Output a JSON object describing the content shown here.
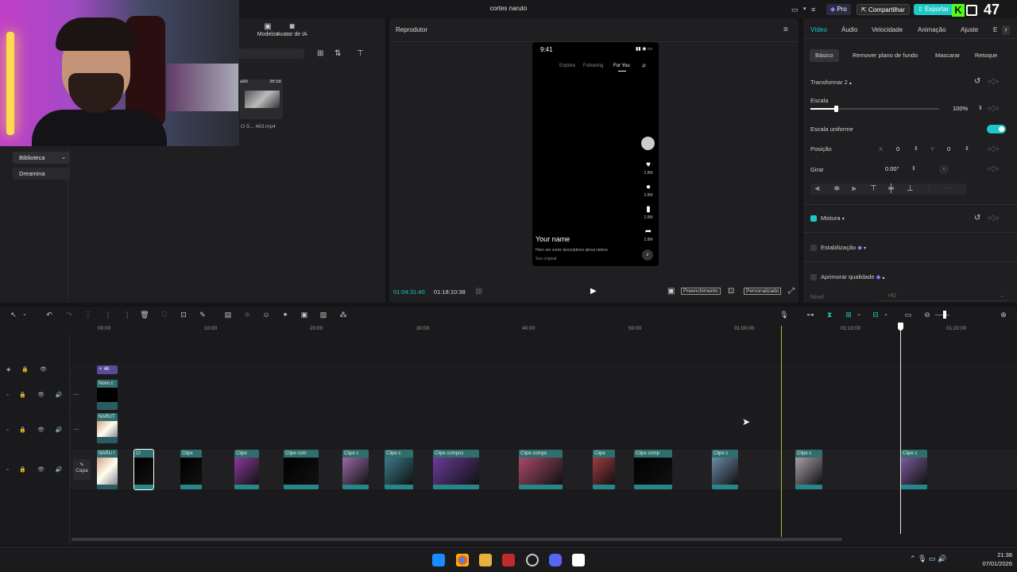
{
  "window": {
    "title": "cortes naruto"
  },
  "header": {
    "pro_label": "Pro",
    "share_label": "Compartilhar",
    "export_label": "Exportar",
    "counter": "47",
    "k_label": "K"
  },
  "media_panel": {
    "tabs": [
      {
        "label": "Modelos"
      },
      {
        "label": "Avatar de IA"
      }
    ],
    "media_item": {
      "name": "O S... 463.mp4",
      "duration": "36:58",
      "badge": "ado"
    },
    "nav": [
      {
        "label": "Biblioteca"
      },
      {
        "label": "Dreamina"
      }
    ]
  },
  "player": {
    "title": "Reprodutor",
    "phone": {
      "time": "9:41",
      "tabs": [
        "Explore",
        "Following",
        "For You"
      ],
      "counts": [
        "2.8M",
        "2.8M",
        "2.8M",
        "2.8M"
      ],
      "username": "Your name",
      "description": "Here are some descriptions about videos",
      "see_original": "See original"
    },
    "current_time": "01:04:31:40",
    "total_time": "01:18:10:38",
    "fill_label": "Preenchimento",
    "custom_label": "Personalizado"
  },
  "inspector": {
    "tabs": [
      "Vídeo",
      "Áudio",
      "Velocidade",
      "Animação",
      "Ajuste",
      "E"
    ],
    "subtabs": [
      "Básico",
      "Remover plano de fundo",
      "Mascarar",
      "Retoque"
    ],
    "transform_label": "Transformar 2",
    "scale_label": "Escala",
    "scale_value": "100%",
    "scale_level": 0.2,
    "uniform_label": "Escala uniforme",
    "position_label": "Posição",
    "x_label": "X",
    "x_value": "0",
    "y_label": "Y",
    "y_value": "0",
    "rotate_label": "Girar",
    "rotate_value": "0.00°",
    "rotate_extra": "-",
    "blend_label": "Mistura",
    "stabilize_label": "Estabilização",
    "enhance_label": "Aprimorar qualidade",
    "level_label": "Nível",
    "level_value": "HD"
  },
  "timeline": {
    "ruler": [
      "00:00",
      "10:00",
      "20:00",
      "30:00",
      "40:00",
      "50:00",
      "01:00:00",
      "01:10:00",
      "01:20:00"
    ],
    "tracks": {
      "effect_label": "4K",
      "text_label": "Novo c",
      "overlay_label": "NARUT",
      "main_label": "NARU I",
      "cover_label": "Capa"
    },
    "clips": [
      {
        "label": "Cl",
        "color": "#000000"
      },
      {
        "label": "Clipe",
        "color": "#000000"
      },
      {
        "label": "Clipe",
        "color": "#8a3a9a"
      },
      {
        "label": "Clipe com",
        "color": "#000000"
      },
      {
        "label": "Clipe c",
        "color": "#9a6aa8"
      },
      {
        "label": "Clipe c",
        "color": "#3a7a8a"
      },
      {
        "label": "Clipe compos",
        "color": "#6a3a9a"
      },
      {
        "label": "Clipe compo",
        "color": "#a84a6a"
      },
      {
        "label": "Clipe",
        "color": "#a03a40"
      },
      {
        "label": "Clipe comp",
        "color": "#000000"
      },
      {
        "label": "Clipe c",
        "color": "#6a8aa8"
      },
      {
        "label": "Clipe c",
        "color": "#a8a0a8"
      },
      {
        "label": "Clipe c",
        "color": "#7a5a9a"
      }
    ]
  },
  "taskbar": {
    "time": "21:38",
    "date": "07/01/2026"
  },
  "colors": {
    "accent": "#1fc7c7",
    "panel": "#1f1f21",
    "background": "#141416",
    "clip_teal": "#2a5d62",
    "playhead": "#e8e8e8",
    "marker": "#b5b53a"
  }
}
